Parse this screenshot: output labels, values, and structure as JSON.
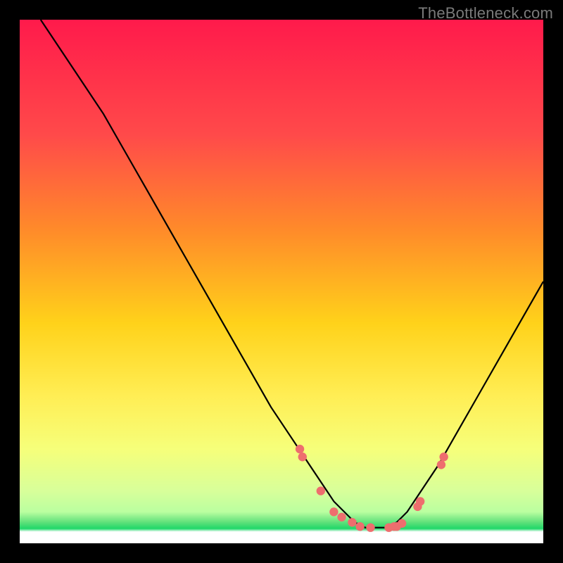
{
  "watermark": "TheBottleneck.com",
  "colors": {
    "gradient_top": "#ff1a4b",
    "gradient_mid1": "#ff6a3a",
    "gradient_mid2": "#ffd21a",
    "gradient_mid3": "#ffee55",
    "gradient_mid4": "#f6ff7a",
    "gradient_green1": "#baffa0",
    "gradient_green2": "#5fe07a",
    "gradient_green3": "#1fd869",
    "gradient_white": "#ffffff",
    "curve": "#000000",
    "dot": "#ee6e6e"
  },
  "chart_data": {
    "type": "line",
    "title": "",
    "xlabel": "",
    "ylabel": "",
    "xlim": [
      0,
      100
    ],
    "ylim": [
      0,
      100
    ],
    "series": [
      {
        "name": "bottleneck-curve",
        "x": [
          4,
          8,
          12,
          16,
          20,
          24,
          28,
          32,
          36,
          40,
          44,
          48,
          52,
          56,
          58,
          60,
          62,
          64,
          66,
          68,
          70,
          72,
          74,
          76,
          80,
          84,
          88,
          92,
          96,
          100
        ],
        "y": [
          100,
          94,
          88,
          82,
          75,
          68,
          61,
          54,
          47,
          40,
          33,
          26,
          20,
          14,
          11,
          8,
          6,
          4,
          3,
          3,
          3,
          4,
          6,
          9,
          15,
          22,
          29,
          36,
          43,
          50
        ]
      }
    ],
    "dots": {
      "name": "highlight-dots",
      "x": [
        53.5,
        54,
        57.5,
        60,
        61.5,
        63.5,
        65,
        67,
        70.5,
        71.5,
        72,
        73,
        76,
        76.5,
        80.5,
        81
      ],
      "y": [
        18,
        16.5,
        10,
        6,
        5,
        4,
        3.2,
        3,
        3,
        3.2,
        3.2,
        3.8,
        7,
        8,
        15,
        16.5
      ]
    }
  }
}
